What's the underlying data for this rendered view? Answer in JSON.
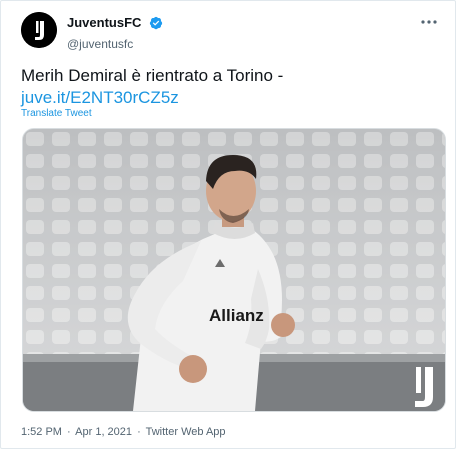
{
  "author": {
    "display_name": "JuventusFC",
    "handle": "@juventusfc",
    "avatar_icon": "juventus-j-logo",
    "verified_icon": "verified-badge-icon",
    "verified_color": "#1d9bf0"
  },
  "menu_icon": "more-dots-icon",
  "tweet": {
    "text": "Merih Demiral è rientrato a Torino - ",
    "link_text": "juve.it/E2NT30rCZ5z",
    "translate_label": "Translate Tweet"
  },
  "media": {
    "jersey_text": "Allianz",
    "watermark_icon": "juventus-logo-watermark"
  },
  "meta": {
    "time": "1:52 PM",
    "separator": "·",
    "date": "Apr 1, 2021",
    "source": "Twitter Web App"
  },
  "colors": {
    "link": "#1b95e0",
    "text": "#0f1419",
    "secondary": "#536471",
    "border": "#e1e8ed"
  }
}
